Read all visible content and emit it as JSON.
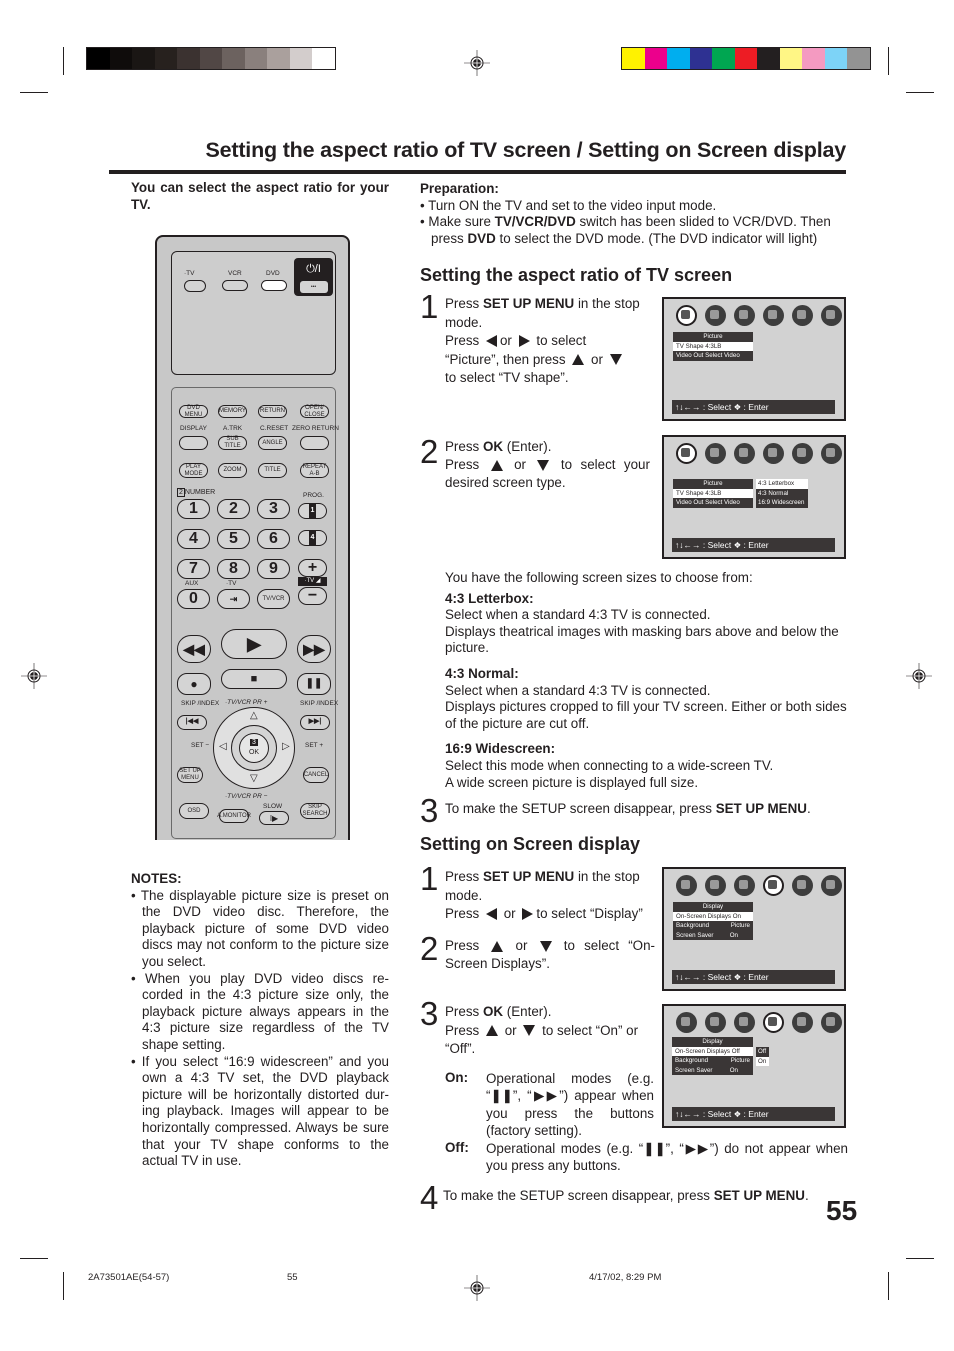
{
  "print_marks": {
    "gray_bars": [
      "#000000",
      "#0f0c0b",
      "#1a1614",
      "#27211e",
      "#3b3230",
      "#514745",
      "#6c625f",
      "#8a807d",
      "#aaa09d",
      "#d3cdcc",
      "#ffffff"
    ],
    "color_bars": [
      "#fff200",
      "#ec008c",
      "#00aeef",
      "#2e3192",
      "#00a651",
      "#ed1c24",
      "#231f20",
      "#fff685",
      "#f49ac1",
      "#7dd3f7",
      "#939393"
    ]
  },
  "page": {
    "title": "Setting the aspect ratio of TV screen / Setting on Screen display",
    "intro": "You can select the aspect ratio for your TV.",
    "page_number": "55"
  },
  "preparation": {
    "heading": "Preparation:",
    "bullet1": "Turn ON the TV and set to the video input mode.",
    "bullet2_a": "Make sure ",
    "bullet2_b": "TV/VCR/DVD",
    "bullet2_c": " switch has been slided to VCR/DVD. Then press ",
    "bullet2_d": "DVD",
    "bullet2_e": " to select the DVD mode. (The DVD indicator will light)"
  },
  "aspect": {
    "heading": "Setting the aspect ratio of TV screen",
    "step1": {
      "num": "1",
      "a": "Press ",
      "b": "SET UP MENU",
      "c": " in the stop mode.",
      "d": "Press",
      "e": "or",
      "f": "to select",
      "g": "“Picture”, then press",
      "h": "or",
      "i": "to select “TV shape”."
    },
    "step2": {
      "num": "2",
      "a": "Press ",
      "b": "OK",
      "c": " (Enter).",
      "d": "Press",
      "e": "or",
      "f": "to select your desired screen type."
    },
    "choose_intro": "You have the following screen sizes to choose from:",
    "options": [
      {
        "title": "4:3 Letterbox:",
        "line1": "Select when a standard 4:3 TV is connected.",
        "line2": "Displays theatrical images with masking bars above and below the picture."
      },
      {
        "title": "4:3 Normal:",
        "line1": "Select when a standard 4:3 TV is connected.",
        "line2": "Displays pictures cropped to fill your TV screen. Either or both sides of the picture are cut off."
      },
      {
        "title": "16:9 Widescreen:",
        "line1": "Select this mode when connecting to a wide-screen TV.",
        "line2": "A wide screen picture is displayed full size."
      }
    ],
    "step3": {
      "num": "3",
      "a": "To make the SETUP screen disappear, press ",
      "b": "SET UP MENU",
      "c": "."
    }
  },
  "osd": {
    "footer": "↑↓←→ : Select ❖ : Enter",
    "screen1": {
      "header": "Picture",
      "rows": [
        {
          "label": "TV Shape 4:3LB",
          "value": ""
        },
        {
          "label": "Video Out Select Video",
          "value": ""
        }
      ]
    },
    "screen2": {
      "header": "Picture",
      "rows": [
        {
          "label": "TV Shape 4:3LB",
          "value": ""
        },
        {
          "label": "Video Out Select Video",
          "value": ""
        }
      ],
      "submenu": [
        "4:3 Letterbox",
        "4:3 Normal",
        "16:9 Widescreen"
      ]
    },
    "screen3": {
      "header": "Display",
      "rows": [
        {
          "label": "On-Screen Displays On",
          "value": ""
        },
        {
          "label": "Background",
          "value": "Picture"
        },
        {
          "label": "Screen Saver",
          "value": "On"
        }
      ]
    },
    "screen4": {
      "header": "Display",
      "rows": [
        {
          "label": "On-Screen Displays Off",
          "value": ""
        },
        {
          "label": "Background",
          "value": "Picture"
        },
        {
          "label": "Screen Saver",
          "value": "On"
        }
      ],
      "submenu": [
        "Off",
        "On"
      ]
    }
  },
  "osd_display": {
    "heading": "Setting on Screen display",
    "step1": {
      "num": "1",
      "a": "Press ",
      "b": "SET UP MENU",
      "c": " in the stop mode.",
      "d": "Press",
      "e": "or",
      "f": "to select “Display”"
    },
    "step2": {
      "num": "2",
      "a": "Press",
      "b": "or",
      "c": "to select “On-Screen Displays”."
    },
    "step3": {
      "num": "3",
      "a": "Press ",
      "b": "OK",
      "c": " (Enter).",
      "d": "Press",
      "e": "or",
      "f": "to select “On” or “Off”."
    },
    "on_label": "On:",
    "on_text": "Operational modes (e.g. “❚❚”, “▶▶”) appear when you press the buttons (factory setting).",
    "off_label": "Off:",
    "off_text": "Operational modes (e.g. “❚❚”, “▶▶”) do not appear when you press any buttons.",
    "step4": {
      "num": "4",
      "a": "To make the SETUP screen disappear, press ",
      "b": "SET UP MENU",
      "c": "."
    }
  },
  "notes": {
    "heading": "NOTES:",
    "items": [
      "The displayable picture size is preset on the DVD video disc. Therefore, the playback picture of some DVD video discs may not conform to the picture size you select.",
      "When you play DVD video discs re-corded in the 4:3 picture size only, the playback picture always appears in the 4:3 picture size regardless of the TV shape setting.",
      "If you select “16:9 widescreen” and you own a 4:3 TV set, the DVD playback picture will be horizontally distorted dur-ing playback. Images will appear to be horizontally compressed. Always be sure that your TV shape conforms to the actual TV in use."
    ]
  },
  "remote": {
    "tv": "·TV",
    "vcr": "VCR",
    "dvd": "DVD",
    "power": "⏻/I",
    "dots": "•••",
    "dvd_menu": "DVD MENU",
    "memory": "MEMORY",
    "return": "RETURN",
    "open_close": "OPEN/ CLOSE",
    "display": "DISPLAY",
    "atrk": "A.TRK",
    "creset": "C.RESET",
    "zero_return": "ZERO RETURN",
    "subtitle": "SUB TITLE",
    "angle": "ANGLE",
    "play_mode": "PLAY MODE",
    "zoom": "ZOOM",
    "title": "TITLE",
    "repeat": "REPEAT A-B",
    "number": "NUMBER",
    "number_badge": "2",
    "prog": "PROG.",
    "digits": [
      "1",
      "2",
      "3",
      "4",
      "5",
      "6",
      "7",
      "8",
      "9",
      "0"
    ],
    "aux": "AUX",
    "tv_small": "·TV",
    "tvvcr": "TV/VCR",
    "tv_vol": "·TV ◢",
    "plus": "+",
    "minus": "−",
    "skip_index": "SKIP /INDEX",
    "tvvcr_pr_plus": "·TV/VCR PR +",
    "tvvcr_pr_minus": "·TV/VCR PR −",
    "set_minus": "SET −",
    "set_plus": "SET +",
    "ok": "OK",
    "ok_badge": "3",
    "setup_menu": "SET UP MENU",
    "cancel": "CANCEL",
    "osd": "OSD",
    "amonitor": "A.MONITOR",
    "slow": "SLOW",
    "skip_search": "SKIP SEARCH"
  },
  "footer": {
    "doc_code": "2A73501AE(54-57)",
    "page": "55",
    "timestamp": "4/17/02, 8:29 PM"
  }
}
